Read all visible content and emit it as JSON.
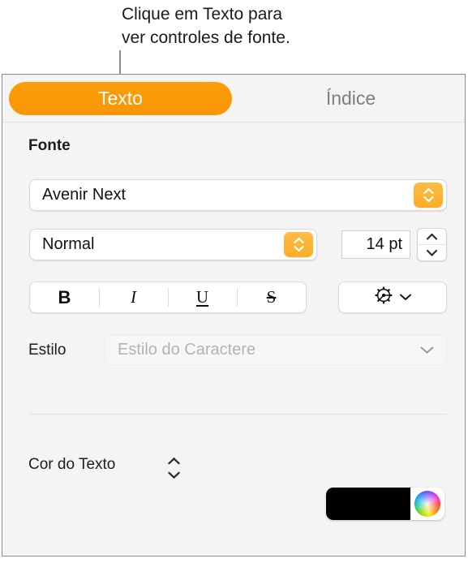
{
  "callout": {
    "text": "Clique em Texto para\nver controles de fonte."
  },
  "tabs": [
    {
      "id": "texto",
      "label": "Texto",
      "selected": true
    },
    {
      "id": "indice",
      "label": "Índice",
      "selected": false
    }
  ],
  "font_section": {
    "heading": "Fonte",
    "family": {
      "value": "Avenir Next",
      "stepper_icon": "up-down-chevron-icon"
    },
    "typeface": {
      "value": "Normal",
      "stepper_icon": "up-down-chevron-icon"
    },
    "size": {
      "value": "14 pt",
      "stepper_up_icon": "chevron-up-icon",
      "stepper_down_icon": "chevron-down-icon"
    },
    "format_buttons": [
      {
        "id": "bold",
        "label": "B"
      },
      {
        "id": "italic",
        "label": "I"
      },
      {
        "id": "underline",
        "label": "U"
      },
      {
        "id": "strikethrough",
        "label": "S"
      }
    ],
    "options_button": {
      "icon": "gear-icon",
      "chevron": "chevron-down-icon"
    }
  },
  "style_row": {
    "label": "Estilo",
    "placeholder": "Estilo do Caractere",
    "chevron": "chevron-down-icon"
  },
  "color_row": {
    "label": "Cor do Texto",
    "stepper_icon": "up-down-chevron-icon",
    "swatch_color": "#000000",
    "wheel_icon": "color-wheel-icon"
  },
  "theme": {
    "accent_orange": "#f99507",
    "stepper_orange": "#fbad27",
    "panel_background": "#f4f4f4",
    "text_primary": "#1d1d1f",
    "text_muted": "#7e7e82",
    "placeholder": "#b3b3b3"
  }
}
